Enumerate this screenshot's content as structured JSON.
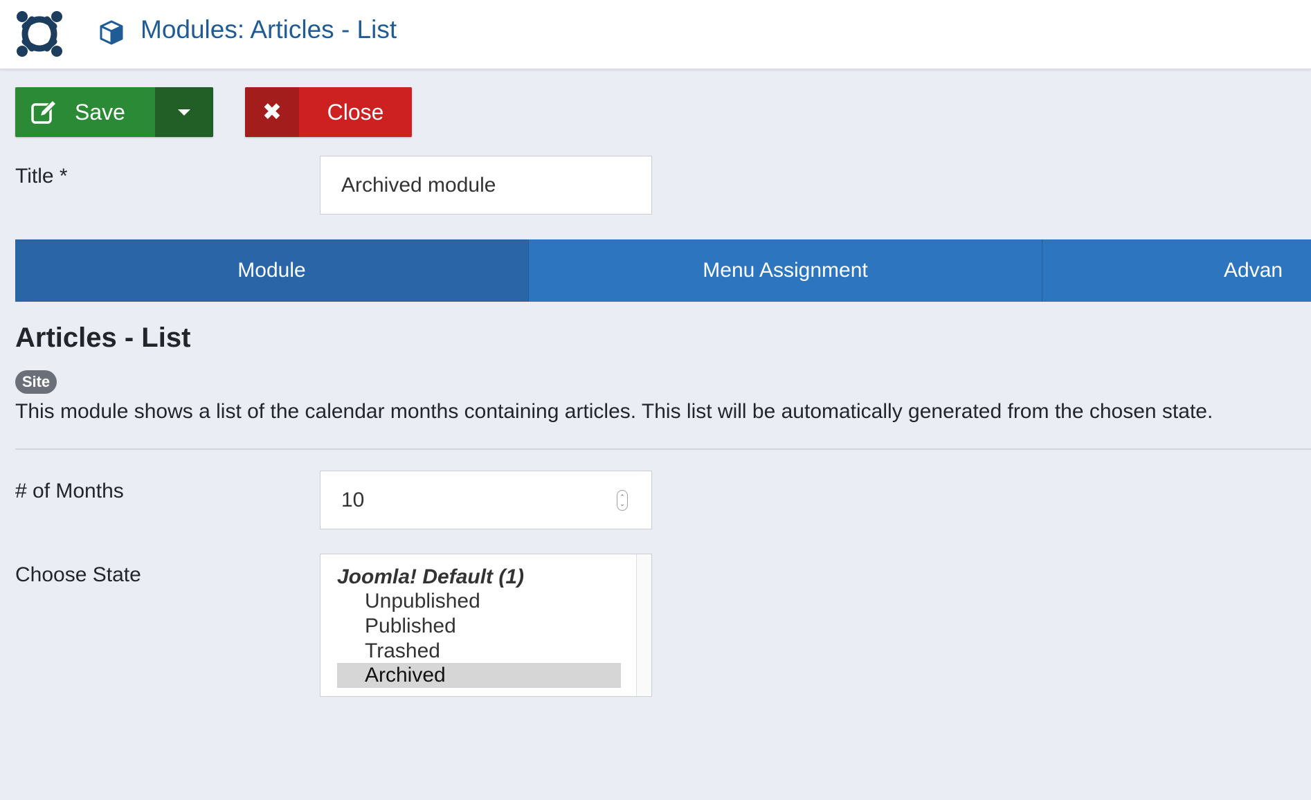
{
  "header": {
    "title": "Modules: Articles - List"
  },
  "toolbar": {
    "save_label": "Save",
    "close_label": "Close"
  },
  "form": {
    "title_label": "Title *",
    "title_value": "Archived module"
  },
  "tabs": [
    {
      "label": "Module",
      "active": true
    },
    {
      "label": "Menu Assignment",
      "active": false
    },
    {
      "label": "Advan",
      "active": false
    }
  ],
  "module": {
    "name": "Articles - List",
    "badge": "Site",
    "description": "This module shows a list of the calendar months containing articles. This list will be automatically generated from the chosen state."
  },
  "fields": {
    "months_label": "# of Months",
    "months_value": "10",
    "state_label": "Choose State",
    "state_group": "Joomla! Default (1)",
    "state_options": [
      {
        "label": "Unpublished",
        "selected": false
      },
      {
        "label": "Published",
        "selected": false
      },
      {
        "label": "Trashed",
        "selected": false
      },
      {
        "label": "Archived",
        "selected": true
      }
    ]
  },
  "colors": {
    "header_title": "#1f5b95",
    "save_green": "#2a8a35",
    "close_red": "#cd2121",
    "tab_blue": "#2d75bf",
    "page_bg": "#eaedf4"
  }
}
